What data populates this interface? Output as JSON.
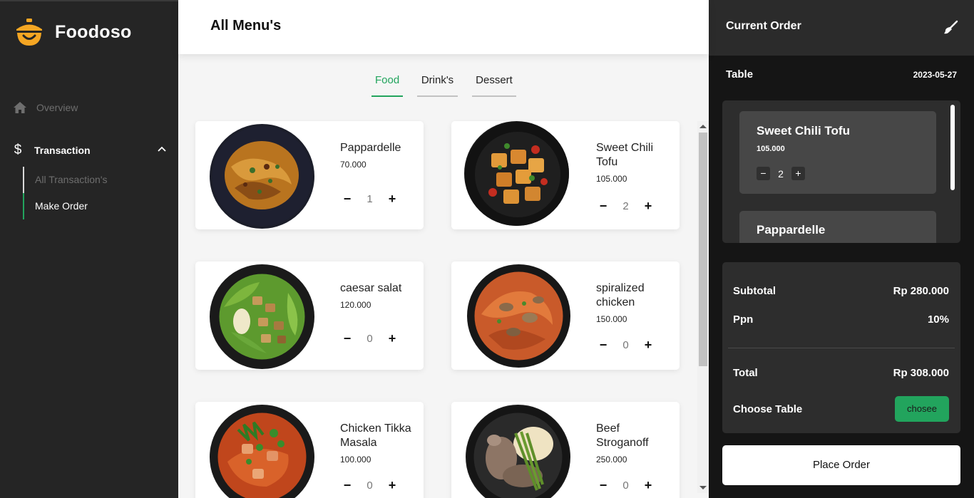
{
  "app": {
    "name": "Foodoso"
  },
  "sidebar": {
    "overview_label": "Overview",
    "transaction_label": "Transaction",
    "dollar_symbol": "$",
    "sub_items": [
      {
        "label": "All Transaction's",
        "active": false
      },
      {
        "label": "Make Order",
        "active": true
      }
    ]
  },
  "main": {
    "title": "All Menu's",
    "tabs": [
      {
        "label": "Food",
        "active": true
      },
      {
        "label": "Drink's",
        "active": false
      },
      {
        "label": "Dessert",
        "active": false
      }
    ],
    "items": [
      {
        "name": "Pappardelle",
        "price": "70.000",
        "qty": "1",
        "minus": "−",
        "plus": "+"
      },
      {
        "name": "Sweet Chili Tofu",
        "price": "105.000",
        "qty": "2",
        "minus": "−",
        "plus": "+"
      },
      {
        "name": "caesar salat",
        "price": "120.000",
        "qty": "0",
        "minus": "−",
        "plus": "+"
      },
      {
        "name": "spiralized chicken",
        "price": "150.000",
        "qty": "0",
        "minus": "−",
        "plus": "+"
      },
      {
        "name": "Chicken Tikka Masala",
        "price": "100.000",
        "qty": "0",
        "minus": "−",
        "plus": "+"
      },
      {
        "name": "Beef Stroganoff",
        "price": "250.000",
        "qty": "0",
        "minus": "−",
        "plus": "+"
      }
    ]
  },
  "order": {
    "title": "Current Order",
    "table_label": "Table",
    "date": "2023-05-27",
    "items": [
      {
        "name": "Sweet Chili Tofu",
        "price": "105.000",
        "qty": "2",
        "minus": "−",
        "plus": "+"
      },
      {
        "name": "Pappardelle"
      }
    ],
    "subtotal_label": "Subtotal",
    "subtotal_value": "Rp 280.000",
    "ppn_label": "Ppn",
    "ppn_value": "10%",
    "total_label": "Total",
    "total_value": "Rp 308.000",
    "choose_table_label": "Choose Table",
    "choose_button": "chosee",
    "place_order_button": "Place Order"
  },
  "colors": {
    "accent": "#22a45d",
    "logo": "#f5a623",
    "sidebar_bg": "#252525",
    "panel_bg": "#151515"
  }
}
